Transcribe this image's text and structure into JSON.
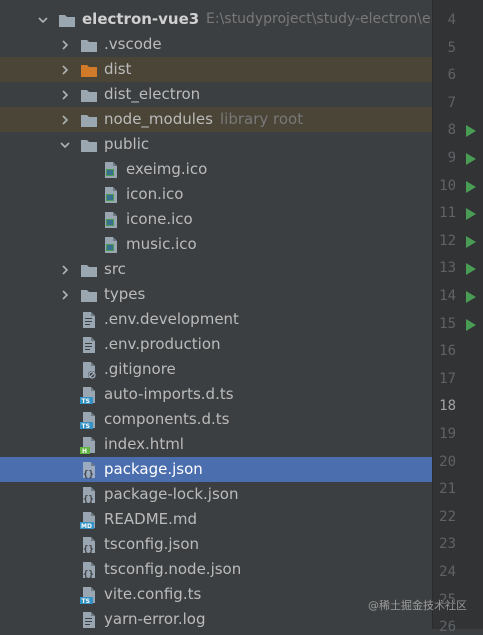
{
  "project": {
    "name": "electron-vue3",
    "path": "E:\\studyproject\\study-electron\\elec"
  },
  "tree": [
    {
      "label": "electron-vue3",
      "hint": "E:\\studyproject\\study-electron\\elec",
      "icon": "folder-icon",
      "depth": 0,
      "expanded": true
    },
    {
      "label": ".vscode",
      "icon": "folder-icon",
      "depth": 1,
      "collapsed": true
    },
    {
      "label": "dist",
      "icon": "excluded-folder-icon",
      "depth": 1,
      "collapsed": true,
      "excluded": true
    },
    {
      "label": "dist_electron",
      "icon": "folder-icon",
      "depth": 1,
      "collapsed": true
    },
    {
      "label": "node_modules",
      "hint": "library root",
      "icon": "folder-icon",
      "depth": 1,
      "collapsed": true,
      "excluded": true
    },
    {
      "label": "public",
      "icon": "folder-icon",
      "depth": 1,
      "expanded": true
    },
    {
      "label": "exeimg.ico",
      "icon": "image-file-icon",
      "depth": 2
    },
    {
      "label": "icon.ico",
      "icon": "image-file-icon",
      "depth": 2
    },
    {
      "label": "icone.ico",
      "icon": "image-file-icon",
      "depth": 2
    },
    {
      "label": "music.ico",
      "icon": "image-file-icon",
      "depth": 2
    },
    {
      "label": "src",
      "icon": "folder-icon",
      "depth": 1,
      "collapsed": true
    },
    {
      "label": "types",
      "icon": "folder-icon",
      "depth": 1,
      "collapsed": true
    },
    {
      "label": ".env.development",
      "icon": "text-file-icon",
      "depth": 1
    },
    {
      "label": ".env.production",
      "icon": "text-file-icon",
      "depth": 1
    },
    {
      "label": ".gitignore",
      "icon": "ignore-file-icon",
      "depth": 1
    },
    {
      "label": "auto-imports.d.ts",
      "icon": "typescript-file-icon",
      "depth": 1
    },
    {
      "label": "components.d.ts",
      "icon": "typescript-file-icon",
      "depth": 1
    },
    {
      "label": "index.html",
      "icon": "html-file-icon",
      "depth": 1
    },
    {
      "label": "package.json",
      "icon": "json-file-icon",
      "depth": 1,
      "selected": true
    },
    {
      "label": "package-lock.json",
      "icon": "json-file-icon",
      "depth": 1
    },
    {
      "label": "README.md",
      "icon": "markdown-file-icon",
      "depth": 1
    },
    {
      "label": "tsconfig.json",
      "icon": "json-file-icon",
      "depth": 1
    },
    {
      "label": "tsconfig.node.json",
      "icon": "json-file-icon",
      "depth": 1
    },
    {
      "label": "vite.config.ts",
      "icon": "typescript-file-icon",
      "depth": 1
    },
    {
      "label": "yarn-error.log",
      "icon": "text-file-icon",
      "depth": 1
    }
  ],
  "gutter": {
    "line_numbers": [
      "4",
      "5",
      "6",
      "7",
      "8",
      "9",
      "10",
      "11",
      "12",
      "13",
      "14",
      "15",
      "16",
      "17",
      "18",
      "19",
      "20",
      "21",
      "22",
      "23",
      "24",
      "25",
      "26"
    ],
    "current_line": "18",
    "run_markers": [
      "8",
      "9",
      "10",
      "11",
      "12",
      "13",
      "14",
      "15"
    ]
  },
  "watermark": "@稀土掘金技术社区",
  "colors": {
    "background": "#3c3f41",
    "selection": "#4b6eaf",
    "excluded_row": "#4a4537",
    "excluded_folder": "#d07a2a",
    "folder": "#9aa7b0",
    "run_marker": "#499c54"
  }
}
